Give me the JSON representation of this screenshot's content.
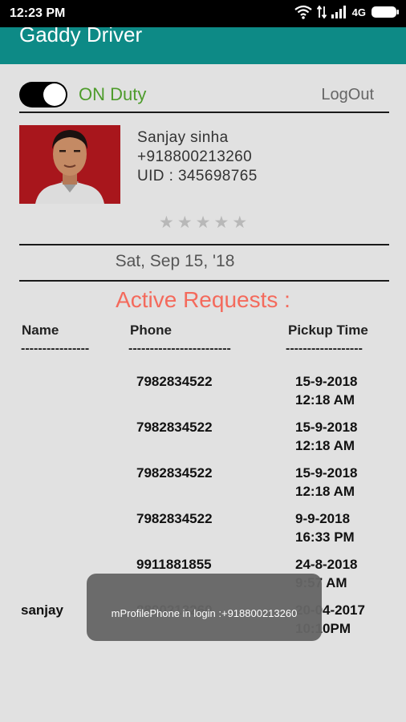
{
  "status_bar": {
    "time": "12:23 PM",
    "network": "4G"
  },
  "app_bar": {
    "title": "Gaddy Driver"
  },
  "duty": {
    "label": "ON Duty",
    "toggle_on": true,
    "logout_label": "LogOut"
  },
  "profile": {
    "name": "Sanjay sinha",
    "phone": "+918800213260",
    "uid": "UID : 345698765",
    "rating": 0,
    "rating_max": 5
  },
  "date": "Sat, Sep 15, '18",
  "active_requests": {
    "title": "Active Requests :",
    "columns": {
      "name": "Name",
      "phone": "Phone",
      "pickup_time": "Pickup Time"
    },
    "dashes": {
      "name": "----------------",
      "phone": "------------------------",
      "pickup_time": "------------------"
    },
    "rows": [
      {
        "name": "",
        "phone": "7982834522",
        "date": "15-9-2018",
        "time": "12:18 AM"
      },
      {
        "name": "",
        "phone": "7982834522",
        "date": "15-9-2018",
        "time": "12:18 AM"
      },
      {
        "name": "",
        "phone": "7982834522",
        "date": "15-9-2018",
        "time": "12:18 AM"
      },
      {
        "name": "",
        "phone": "7982834522",
        "date": "9-9-2018",
        "time": "16:33 PM"
      },
      {
        "name": "",
        "phone": "9911881855",
        "date": "24-8-2018",
        "time": "9:57 AM"
      },
      {
        "name": "sanjay",
        "phone": "8800213260",
        "date": "20-04-2017",
        "time": "10:10PM"
      }
    ]
  },
  "toast": {
    "message": "mProfilePhone in login :+918800213260"
  },
  "colors": {
    "app_bar": "#0d8a86",
    "duty_label": "#4e9c2c",
    "section_title": "#f46a5c",
    "photo_background": "#a8161c"
  },
  "icons": [
    "wifi-icon",
    "data-transfer-icon",
    "signal-icon",
    "battery-icon",
    "star-icon"
  ]
}
